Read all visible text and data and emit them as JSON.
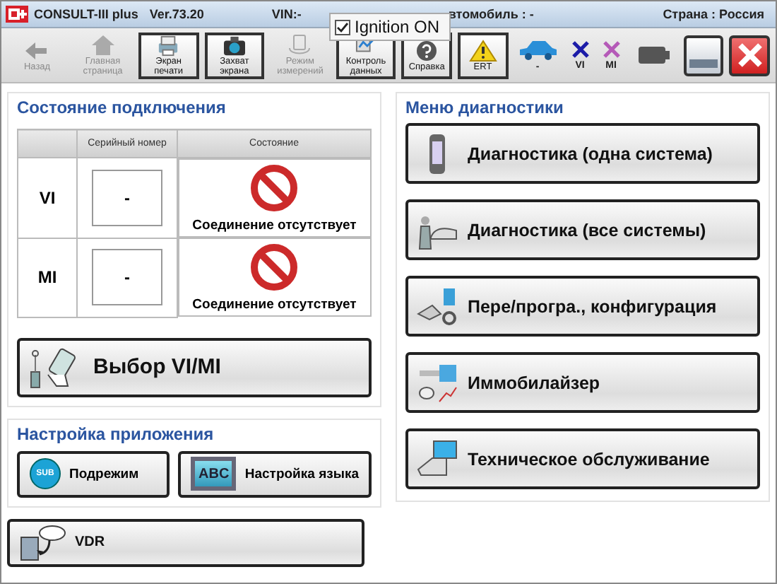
{
  "title_bar": {
    "app": "CONSULT-III plus",
    "version": "Ver.73.20",
    "vin": "VIN:-",
    "vehicle": "втомобиль : -",
    "country": "Страна : Россия"
  },
  "ignition": {
    "label": "Ignition ON",
    "checked": true
  },
  "toolbar": [
    {
      "kind": "back",
      "label": "Назад",
      "disabled": true
    },
    {
      "kind": "home",
      "label": "Главная страница",
      "disabled": true
    },
    {
      "kind": "print",
      "label": "Экран печати",
      "disabled": false
    },
    {
      "kind": "camera",
      "label": "Захват экрана",
      "disabled": false
    },
    {
      "kind": "meter",
      "label": "Режим измерений",
      "disabled": true
    },
    {
      "kind": "data",
      "label": "Контроль данных",
      "disabled": false
    },
    {
      "kind": "help",
      "label": "Справка",
      "disabled": false
    },
    {
      "kind": "warning",
      "label": "ERT",
      "disabled": false
    }
  ],
  "indicators": [
    {
      "kind": "car",
      "label": "-"
    },
    {
      "kind": "cross",
      "label": "VI",
      "color": "#1c1ca8"
    },
    {
      "kind": "cross",
      "label": "MI",
      "color": "#b55ab8"
    }
  ],
  "connection": {
    "title": "Состояние подключения",
    "columns": [
      "Серийный номер",
      "Состояние"
    ],
    "rows": [
      {
        "label": "VI",
        "serial": "-",
        "status": "Соединение отсутствует"
      },
      {
        "label": "MI",
        "serial": "-",
        "status": "Соединение отсутствует"
      }
    ],
    "button": "Выбор VI/MI"
  },
  "app_settings": {
    "title": "Настройка приложения",
    "buttons": [
      {
        "kind": "sub",
        "icon_text": "SUB",
        "label": "Подрежим"
      },
      {
        "kind": "abc",
        "icon_text": "ABC",
        "label": "Настройка языка"
      }
    ]
  },
  "vdr_button": "VDR",
  "diagnostics": {
    "title": "Меню диагностики",
    "buttons": [
      {
        "kind": "device",
        "label": "Диагностика (одна система)"
      },
      {
        "kind": "mechanic",
        "label": "Диагностика (все системы)"
      },
      {
        "kind": "program",
        "label": "Пере/програ., конфигурация"
      },
      {
        "kind": "key",
        "label": "Иммобилайзер"
      },
      {
        "kind": "service",
        "label": "Техническое обслуживание"
      }
    ]
  }
}
